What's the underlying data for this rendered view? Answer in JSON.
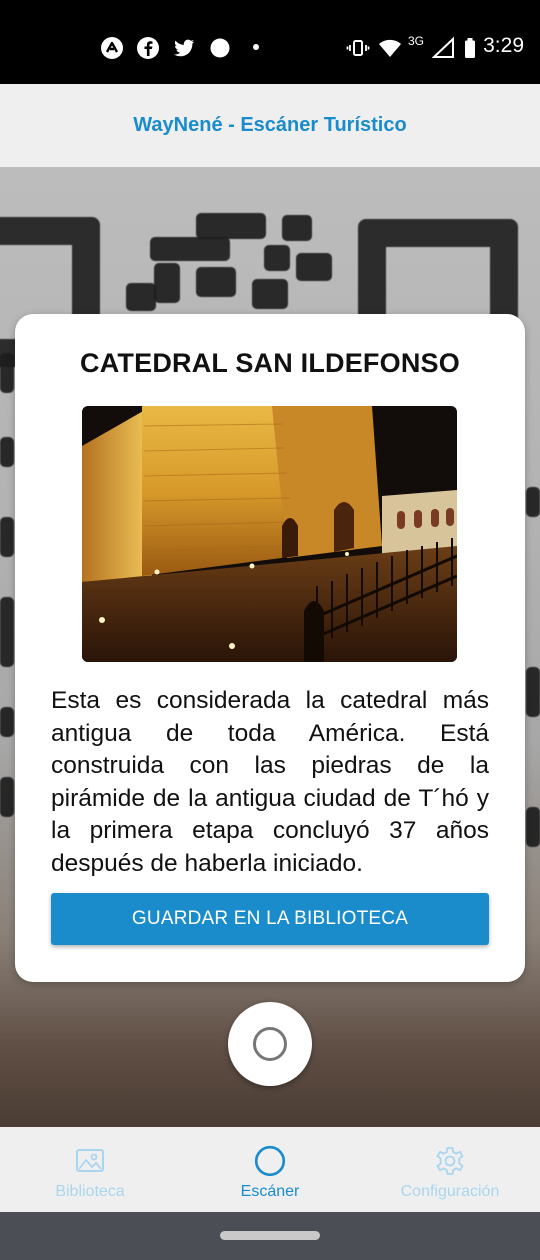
{
  "status_bar": {
    "time": "3:29",
    "network_type": "3G",
    "left_icons": [
      "app-notification-icon",
      "facebook-icon",
      "twitter-icon",
      "circle-notification-icon",
      "dot-icon"
    ],
    "right_icons": [
      "vibrate-icon",
      "wifi-icon",
      "signal-icon",
      "battery-icon"
    ]
  },
  "app_bar": {
    "title": "WayNené - Escáner Turístico"
  },
  "card": {
    "title": "CATEDRAL SAN ILDEFONSO",
    "description": "Esta es considerada la catedral más antigua de toda América. Está construida con las piedras de la pirámide de la antigua ciudad de T´hó y la primera etapa concluyó 37 años después de haberla iniciado.",
    "save_button": "GUARDAR EN LA BIBLIOTECA"
  },
  "bottom_nav": {
    "items": [
      {
        "label": "Biblioteca",
        "icon": "image-icon",
        "active": false
      },
      {
        "label": "Escáner",
        "icon": "scanner-circle-icon",
        "active": true
      },
      {
        "label": "Configuración",
        "icon": "gear-icon",
        "active": false
      }
    ]
  },
  "colors": {
    "accent": "#1a8ccc",
    "inactive_nav": "#a9d6ee",
    "app_bar_bg": "#efefef"
  }
}
